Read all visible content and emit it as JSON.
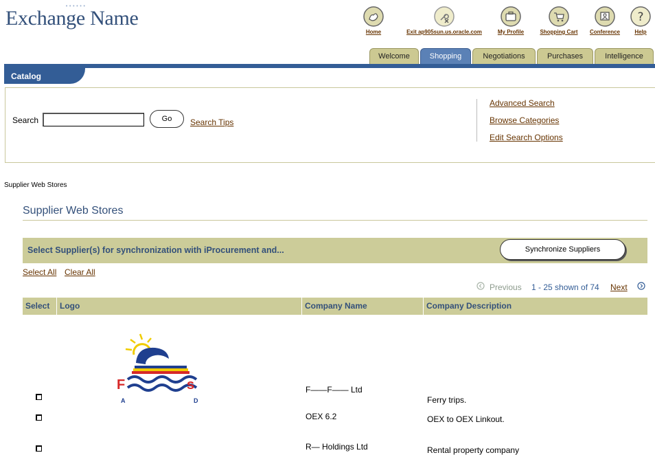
{
  "header": {
    "brand": "Exchange Name",
    "brand_dots": "••••••",
    "global_links": [
      {
        "label": "Home",
        "icon": "home-icon"
      },
      {
        "label": "Exit ap905sun.us.oracle.com",
        "icon": "exit-key-icon"
      },
      {
        "label": "My Profile",
        "icon": "briefcase-icon"
      },
      {
        "label": "Shopping Cart",
        "icon": "shopping-cart-icon"
      },
      {
        "label": "Conference",
        "icon": "conference-icon"
      },
      {
        "label": "Help",
        "icon": "help-icon"
      }
    ]
  },
  "tabs": [
    {
      "label": "Welcome",
      "active": false
    },
    {
      "label": "Shopping",
      "active": true
    },
    {
      "label": "Negotiations",
      "active": false
    },
    {
      "label": "Purchases",
      "active": false
    },
    {
      "label": "Intelligence",
      "active": false
    }
  ],
  "subtab": {
    "label": "Catalog"
  },
  "search": {
    "label": "Search",
    "value": "",
    "go_label": "Go",
    "tips_label": "Search Tips",
    "links": [
      "Advanced Search",
      "Browse Categories",
      "Edit Search Options"
    ]
  },
  "breadcrumb": "Supplier Web Stores",
  "page_title": "Supplier Web Stores",
  "sync": {
    "text": "Select Supplier(s) for synchronization with iProcurement and...",
    "button_label": "Synchronize Suppliers"
  },
  "selection": {
    "select_all": "Select All",
    "clear_all": "Clear All"
  },
  "pagination": {
    "previous": "Previous",
    "range": "1 - 25 shown of 74",
    "next": "Next"
  },
  "table": {
    "headers": [
      "Select",
      "Logo",
      "Company Name",
      "Company Description"
    ],
    "rows": [
      {
        "company": "F——F—— Ltd",
        "description": "Ferry trips.",
        "logo": "FAS-logo"
      },
      {
        "company": "OEX 6.2",
        "description": "OEX to OEX Linkout.",
        "logo": ""
      },
      {
        "company": "R— Holdings Ltd",
        "description": "Rental property company",
        "logo": ""
      }
    ]
  },
  "colors": {
    "brand": "#33507a",
    "tab_bg": "#ccc992",
    "tab_active": "#5b81b6",
    "bar": "#335d96",
    "table_header": "#cccc99",
    "link": "#663300"
  }
}
